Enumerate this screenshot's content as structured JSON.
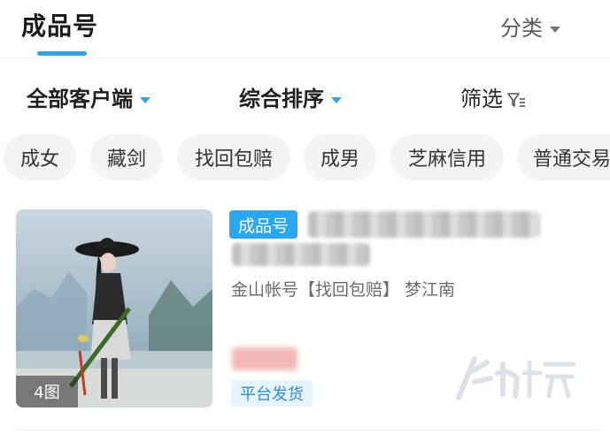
{
  "header": {
    "title": "成品号",
    "category_label": "分类"
  },
  "filters": {
    "client": "全部客户端",
    "sort": "综合排序",
    "filter": "筛选"
  },
  "chips": [
    "成女",
    "藏剑",
    "找回包赔",
    "成男",
    "芝麻信用",
    "普通交易"
  ],
  "listing": {
    "badge": "成品号",
    "subtitle": "金山帐号【找回包赔】 梦江南",
    "image_count": "4图",
    "tag": "平台发货"
  },
  "colors": {
    "accent": "#2aa6f0",
    "badge": "#28a8f2",
    "tag_text": "#2a8fd8"
  }
}
